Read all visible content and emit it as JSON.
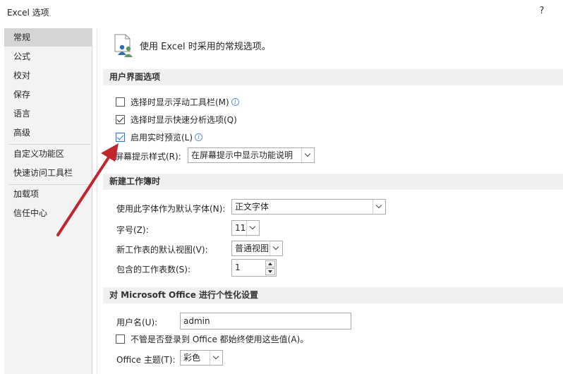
{
  "window": {
    "title": "Excel 选项",
    "help": "?"
  },
  "sidebar": {
    "items": [
      {
        "label": "常规"
      },
      {
        "label": "公式"
      },
      {
        "label": "校对"
      },
      {
        "label": "保存"
      },
      {
        "label": "语言"
      },
      {
        "label": "高级"
      },
      {
        "label": "自定义功能区"
      },
      {
        "label": "快速访问工具栏"
      },
      {
        "label": "加载项"
      },
      {
        "label": "信任中心"
      }
    ]
  },
  "header": {
    "text": "使用 Excel 时采用的常规选项。",
    "icon": "options-people-icon"
  },
  "ui_section": {
    "title": "用户界面选项",
    "mini_toolbar": {
      "label": "选择时显示浮动工具栏(M)",
      "checked": false
    },
    "quick_analysis": {
      "label": "选择时显示快速分析选项(Q)",
      "checked": true
    },
    "live_preview": {
      "label": "启用实时预览(L)",
      "checked": true
    },
    "screentip": {
      "label": "屏幕提示样式(R):",
      "value": "在屏幕提示中显示功能说明"
    }
  },
  "workbook_section": {
    "title": "新建工作簿时",
    "font": {
      "label": "使用此字体作为默认字体(N):",
      "value": "正文字体"
    },
    "size": {
      "label": "字号(Z):",
      "value": "11"
    },
    "view": {
      "label": "新工作表的默认视图(V):",
      "value": "普通视图"
    },
    "sheets": {
      "label": "包含的工作表数(S):",
      "value": "1"
    }
  },
  "personalize_section": {
    "title": "对 Microsoft Office 进行个性化设置",
    "username": {
      "label": "用户名(U):",
      "value": "admin"
    },
    "always_use": {
      "label": "不管是否登录到 Office 都始终使用这些值(A)。",
      "checked": false
    },
    "theme": {
      "label": "Office 主题(T):",
      "value": "彩色"
    }
  },
  "colors": {
    "annotation_arrow": "#c0272d",
    "section_bg": "#f0f0f0",
    "sidebar_bg": "#f3f3f3",
    "check_accent": "#2b78c2"
  }
}
